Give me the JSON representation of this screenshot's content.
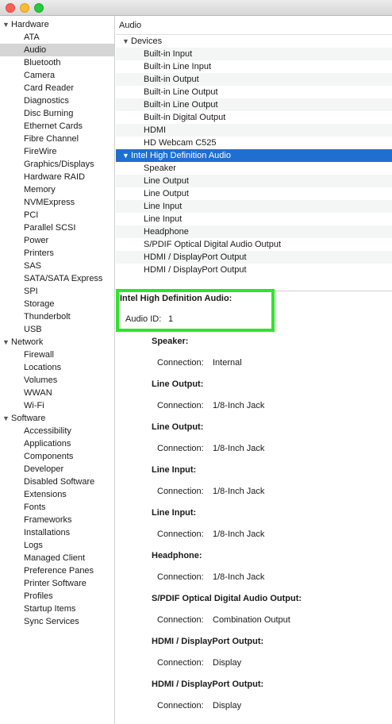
{
  "window": {
    "controls": [
      "close",
      "minimize",
      "zoom"
    ]
  },
  "sidebar": {
    "groups": [
      {
        "label": "Hardware",
        "items": [
          "ATA",
          "Audio",
          "Bluetooth",
          "Camera",
          "Card Reader",
          "Diagnostics",
          "Disc Burning",
          "Ethernet Cards",
          "Fibre Channel",
          "FireWire",
          "Graphics/Displays",
          "Hardware RAID",
          "Memory",
          "NVMExpress",
          "PCI",
          "Parallel SCSI",
          "Power",
          "Printers",
          "SAS",
          "SATA/SATA Express",
          "SPI",
          "Storage",
          "Thunderbolt",
          "USB"
        ]
      },
      {
        "label": "Network",
        "items": [
          "Firewall",
          "Locations",
          "Volumes",
          "WWAN",
          "Wi-Fi"
        ]
      },
      {
        "label": "Software",
        "items": [
          "Accessibility",
          "Applications",
          "Components",
          "Developer",
          "Disabled Software",
          "Extensions",
          "Fonts",
          "Frameworks",
          "Installations",
          "Logs",
          "Managed Client",
          "Preference Panes",
          "Printer Software",
          "Profiles",
          "Startup Items",
          "Sync Services"
        ]
      }
    ],
    "selected": "Audio"
  },
  "main": {
    "header": "Audio",
    "tree": {
      "devices_label": "Devices",
      "devices": [
        "Built-in Input",
        "Built-in Line Input",
        "Built-in Output",
        "Built-in Line Output",
        "Built-in Line Output",
        "Built-in Digital Output",
        "HDMI",
        "HD Webcam C525"
      ],
      "controller_label": "Intel High Definition Audio",
      "controller_items": [
        "Speaker",
        "Line Output",
        "Line Output",
        "Line Input",
        "Line Input",
        "Headphone",
        "S/PDIF Optical Digital Audio Output",
        "HDMI / DisplayPort Output",
        "HDMI / DisplayPort Output"
      ]
    },
    "detail": {
      "title": "Intel High Definition Audio:",
      "audio_id_label": "Audio ID:",
      "audio_id_value": "1",
      "connection_label": "Connection:",
      "entries": [
        {
          "name": "Speaker:",
          "connection": "Internal"
        },
        {
          "name": "Line Output:",
          "connection": "1/8-Inch Jack"
        },
        {
          "name": "Line Output:",
          "connection": "1/8-Inch Jack"
        },
        {
          "name": "Line Input:",
          "connection": "1/8-Inch Jack"
        },
        {
          "name": "Line Input:",
          "connection": "1/8-Inch Jack"
        },
        {
          "name": "Headphone:",
          "connection": "1/8-Inch Jack"
        },
        {
          "name": "S/PDIF Optical Digital Audio Output:",
          "connection": "Combination Output"
        },
        {
          "name": "HDMI / DisplayPort Output:",
          "connection": "Display"
        },
        {
          "name": "HDMI / DisplayPort Output:",
          "connection": "Display"
        }
      ]
    },
    "highlight_color": "#2ee52a",
    "selection_color": "#1f6fd0"
  }
}
